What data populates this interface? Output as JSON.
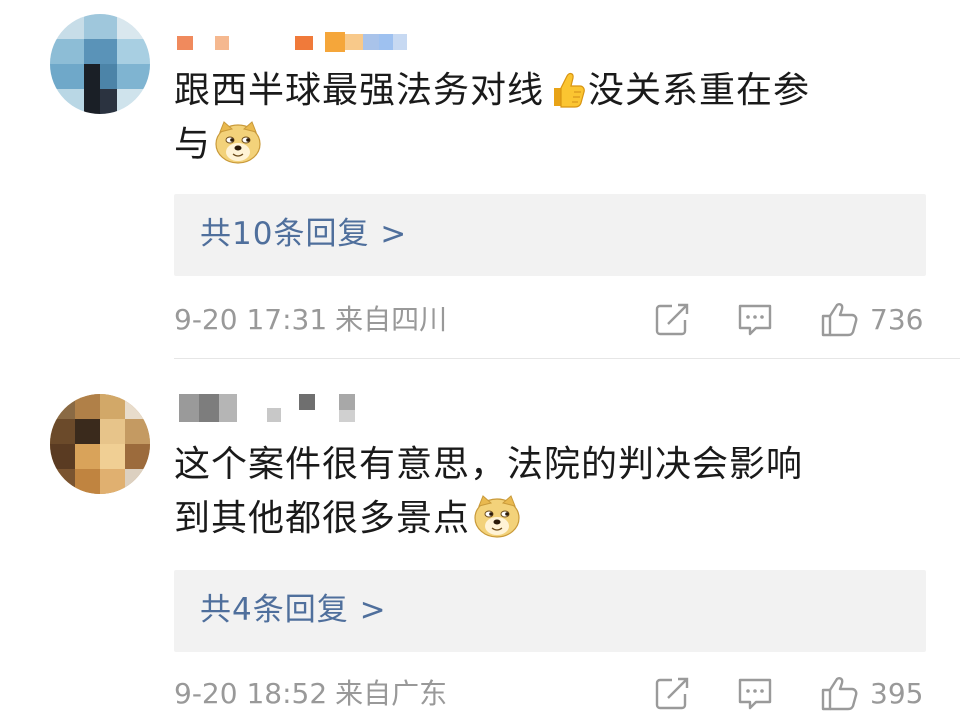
{
  "comments": [
    {
      "text_line1": "跟西半球最强法务对线",
      "text_line1b": "没关系重在参",
      "text_line2": "与",
      "emojis": [
        "thumbs-up-emoji",
        "doge-emoji"
      ],
      "replies_label": "共10条回复 >",
      "time": "9-20 17:31",
      "location": "来自四川",
      "likes": "736",
      "avatar_colors": [
        "#6fa8c9",
        "#1a1f26",
        "#a8cfe2",
        "#d9e7ee"
      ]
    },
    {
      "text_line1": "这个案件很有意思，法院的判决会影响",
      "text_line2": "到其他都很多景点",
      "emojis": [
        "doge-emoji"
      ],
      "replies_label": "共4条回复 >",
      "time": "9-20 18:52",
      "location": "来自广东",
      "likes": "395",
      "avatar_colors": [
        "#6b4a2a",
        "#b88a4e",
        "#e7c48a",
        "#3a2a1c"
      ]
    }
  ],
  "icons": {
    "repost": "repost-icon",
    "comment": "comment-icon",
    "like": "like-icon"
  },
  "colors": {
    "text": "#1a1a1a",
    "link": "#4f6f9c",
    "meta": "#999999",
    "reply_bg": "#f2f2f2"
  }
}
